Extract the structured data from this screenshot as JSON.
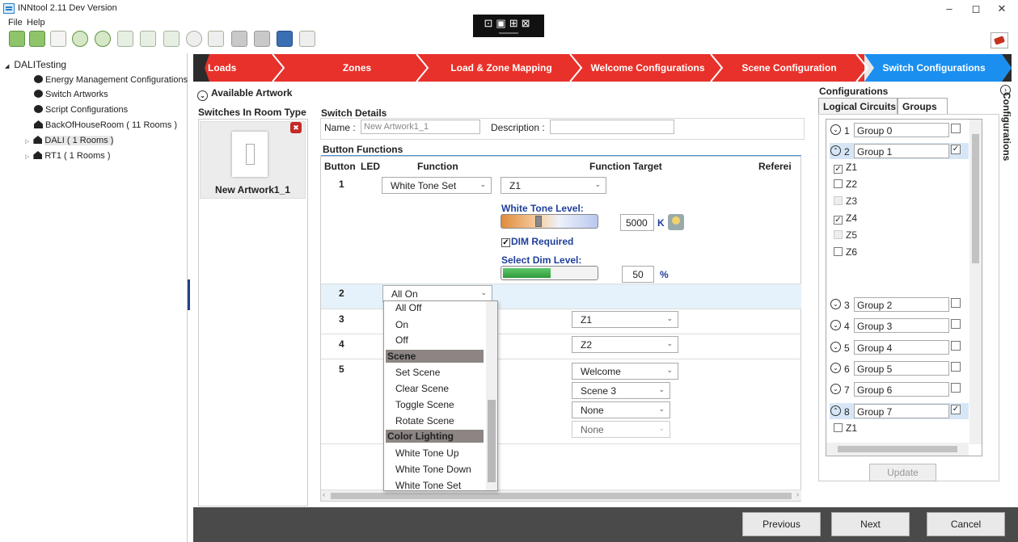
{
  "window": {
    "title": "INNtool 2.11 Dev Version",
    "minimize": "–",
    "maximize": "◻",
    "close": "✕"
  },
  "menu": {
    "file": "File",
    "help": "Help"
  },
  "floatbar": {
    "icons": "⊡▣⊞⊠"
  },
  "tree": {
    "root": "DALITesting",
    "items": [
      {
        "label": "Energy Management Configurations",
        "icon": "gear-icon"
      },
      {
        "label": "Switch Artworks",
        "icon": "gear-icon"
      },
      {
        "label": "Script Configurations",
        "icon": "gear-icon"
      },
      {
        "label": "BackOfHouseRoom ( 11 Rooms )",
        "icon": "house-icon"
      },
      {
        "label": "DALI ( 1 Rooms )",
        "icon": "house-icon"
      },
      {
        "label": "RT1 ( 1 Rooms )",
        "icon": "house-icon"
      }
    ],
    "expander_open": "◢",
    "expander_closed": "▷"
  },
  "nav": {
    "items": [
      "Loads",
      "Zones",
      "Load & Zone Mapping",
      "Welcome Configurations",
      "Scene Configuration",
      "Switch Configurations"
    ],
    "color_red": "#e8312a",
    "color_blue": "#1a8ff0"
  },
  "available": {
    "label": "Available Artwork",
    "toggle": "⌄"
  },
  "switches": {
    "header": "Switches In Room Type",
    "artwork_name": "New Artwork1_1",
    "delete": "✖"
  },
  "details": {
    "header": "Switch Details",
    "name_label": "Name :",
    "name_value": "New Artwork1_1",
    "desc_label": "Description :",
    "desc_value": ""
  },
  "button_functions": {
    "header": "Button Functions",
    "columns": [
      "Button",
      "LED",
      "Function",
      "Function Target",
      "Referei"
    ],
    "rows": [
      {
        "num": "1",
        "function": "White Tone Set",
        "target": "Z1"
      },
      {
        "num": "2",
        "function": "All On"
      },
      {
        "num": "3",
        "target": "Z1"
      },
      {
        "num": "4",
        "target": "Z2"
      },
      {
        "num": "5",
        "target": "Welcome",
        "target2": "Scene 3",
        "target3": "None",
        "target4": "None"
      }
    ],
    "white_tone_label": "White Tone Level:",
    "white_tone_value": "5000",
    "white_tone_unit": "K",
    "dim_required": "DIM Required",
    "dim_check": "✓",
    "dim_level_label": "Select Dim Level:",
    "dim_level_value": "50",
    "dim_level_unit": "%",
    "dim_level_fraction": 0.5
  },
  "dropdown": {
    "items_top": [
      "All Off",
      "On",
      "Off"
    ],
    "group1": "Scene",
    "items_scene": [
      "Set Scene",
      "Clear Scene",
      "Toggle Scene",
      "Rotate Scene"
    ],
    "group2": "Color Lighting",
    "items_color": [
      "White Tone Up",
      "White Tone Down",
      "White Tone Set"
    ]
  },
  "configurations": {
    "title": "Configurations",
    "vertical_label": "Configurations",
    "tabs": [
      "Logical Circuits",
      "Groups"
    ],
    "groups": [
      {
        "num": "1",
        "name": "Group 0",
        "checked": "",
        "expand": "⌄"
      },
      {
        "num": "2",
        "name": "Group 1",
        "checked": "✓",
        "expand": "⌃"
      },
      {
        "num": "3",
        "name": "Group 2",
        "checked": "",
        "expand": "⌄"
      },
      {
        "num": "4",
        "name": "Group 3",
        "checked": "",
        "expand": "⌄"
      },
      {
        "num": "5",
        "name": "Group 4",
        "checked": "",
        "expand": "⌄"
      },
      {
        "num": "6",
        "name": "Group 5",
        "checked": "",
        "expand": "⌄"
      },
      {
        "num": "7",
        "name": "Group 6",
        "checked": "",
        "expand": "⌄"
      },
      {
        "num": "8",
        "name": "Group 7",
        "checked": "✓",
        "expand": "⌃"
      }
    ],
    "group1_zones": [
      {
        "label": "Z1",
        "checked": "✓"
      },
      {
        "label": "Z2",
        "checked": ""
      },
      {
        "label": "Z3",
        "checked": ""
      },
      {
        "label": "Z4",
        "checked": "✓"
      },
      {
        "label": "Z5",
        "checked": ""
      },
      {
        "label": "Z6",
        "checked": ""
      }
    ],
    "group7_zones": [
      {
        "label": "Z1",
        "checked": ""
      }
    ],
    "update": "Update"
  },
  "footer": {
    "previous": "Previous",
    "next": "Next",
    "cancel": "Cancel"
  }
}
